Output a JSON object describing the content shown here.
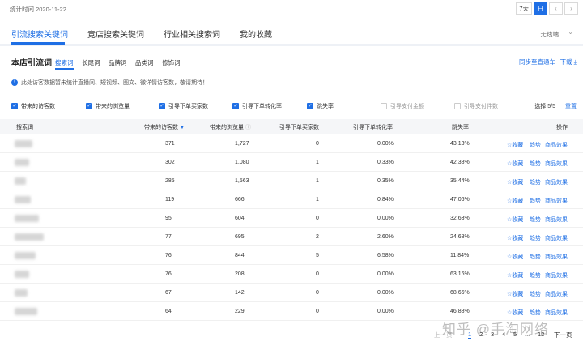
{
  "header": {
    "stat_date": "统计时间 2020-11-22",
    "range_buttons": [
      "7天",
      "日"
    ],
    "prev_icon": "chevron-left-icon",
    "next_icon": "chevron-right-icon"
  },
  "tabs": [
    {
      "label": "引流搜索关键词"
    },
    {
      "label": "竞店搜索关键词"
    },
    {
      "label": "行业相关搜索词"
    },
    {
      "label": "我的收藏"
    }
  ],
  "terminal": "无线端",
  "section": {
    "title": "本店引流词",
    "subtabs": [
      "搜索词",
      "长尾词",
      "品牌词",
      "品类词",
      "修饰词"
    ],
    "sync": "同步至直通车",
    "download": "下载"
  },
  "notice": "此处访客数据暂未统计直播间、短视频、图文、微详情访客数，敬请期待！",
  "metrics": [
    {
      "label": "带来的访客数",
      "checked": "✓"
    },
    {
      "label": "带来的浏览量",
      "checked": "✓"
    },
    {
      "label": "引导下单买家数",
      "checked": "✓"
    },
    {
      "label": "引导下单转化率",
      "checked": "✓"
    },
    {
      "label": "跳失率",
      "checked": "✓"
    },
    {
      "label": "引导支付金额",
      "checked": ""
    },
    {
      "label": "引导支付件数",
      "checked": ""
    }
  ],
  "select_count": "选择 5/5",
  "reset": "重置",
  "columns": [
    "搜索词",
    "带来的访客数",
    "带来的浏览量",
    "引导下单买家数",
    "引导下单转化率",
    "跳失率",
    "操作"
  ],
  "actions": {
    "fav": "☆收藏",
    "trend": "趋势",
    "effect": "商品效果"
  },
  "rows": [
    {
      "visitors": "371",
      "pv": "1,727",
      "buyers": "0",
      "conv": "0.00%",
      "bounce": "43.13%"
    },
    {
      "visitors": "302",
      "pv": "1,080",
      "buyers": "1",
      "conv": "0.33%",
      "bounce": "42.38%"
    },
    {
      "visitors": "285",
      "pv": "1,563",
      "buyers": "1",
      "conv": "0.35%",
      "bounce": "35.44%"
    },
    {
      "visitors": "119",
      "pv": "666",
      "buyers": "1",
      "conv": "0.84%",
      "bounce": "47.06%"
    },
    {
      "visitors": "95",
      "pv": "604",
      "buyers": "0",
      "conv": "0.00%",
      "bounce": "32.63%"
    },
    {
      "visitors": "77",
      "pv": "695",
      "buyers": "2",
      "conv": "2.60%",
      "bounce": "24.68%"
    },
    {
      "visitors": "76",
      "pv": "844",
      "buyers": "5",
      "conv": "6.58%",
      "bounce": "11.84%"
    },
    {
      "visitors": "76",
      "pv": "208",
      "buyers": "0",
      "conv": "0.00%",
      "bounce": "63.16%"
    },
    {
      "visitors": "67",
      "pv": "142",
      "buyers": "0",
      "conv": "0.00%",
      "bounce": "68.66%"
    },
    {
      "visitors": "64",
      "pv": "229",
      "buyers": "0",
      "conv": "0.00%",
      "bounce": "46.88%"
    }
  ],
  "pagination": {
    "prev": "上一页",
    "pages": [
      "1",
      "2",
      "3",
      "4",
      "5"
    ],
    "ellipsis": "...",
    "last": "12",
    "next": "下一页"
  },
  "watermark": "知乎 @手淘网络",
  "colors": {
    "accent": "#1f6fe5",
    "header_bg": "#f5f6f8"
  }
}
